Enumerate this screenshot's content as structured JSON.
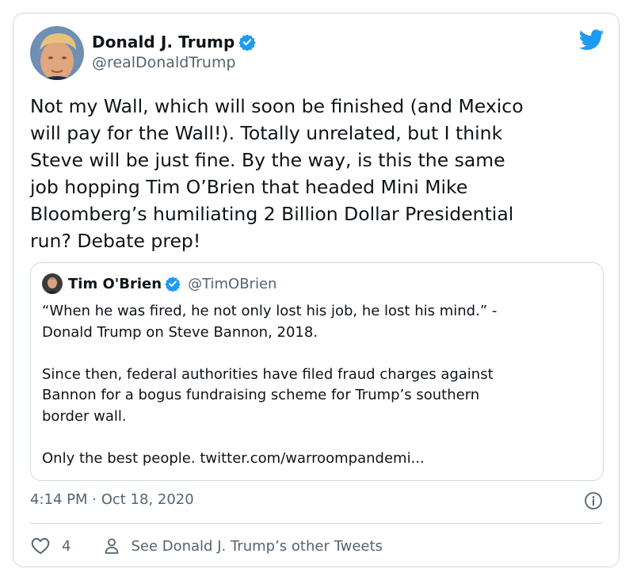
{
  "author": {
    "display_name": "Donald J. Trump",
    "handle": "@realDonaldTrump",
    "verified": true
  },
  "tweet": {
    "text": "Not my Wall, which will soon be finished (and Mexico\nwill pay for the Wall!). Totally unrelated, but I think\nSteve will be just fine. By the way, is this the same\njob hopping Tim O’Brien that headed Mini Mike\nBloomberg’s humiliating 2 Billion Dollar Presidential\nrun? Debate prep!",
    "timestamp": "4:14 PM · Oct 18, 2020"
  },
  "quoted_tweet": {
    "display_name": "Tim O'Brien",
    "handle": "@TimOBrien",
    "verified": true,
    "text": "“When he was fired, he not only lost his job, he lost his mind.” -\nDonald Trump on Steve Bannon, 2018.\n\nSince then, federal authorities have filed fraud charges against\nBannon for a bogus fundraising scheme for Trump’s southern\nborder wall.\n\nOnly the best people. twitter.com/warroompandemi..."
  },
  "actions": {
    "like_count": "4",
    "other_tweets_label": "See Donald J. Trump’s other Tweets"
  },
  "icons": {
    "brand": "twitter-bird-icon",
    "verified": "verified-badge-icon",
    "like": "heart-icon",
    "profile": "person-icon",
    "info": "info-icon"
  },
  "colors": {
    "brand_blue": "#1d9bf0",
    "text_primary": "#0f1419",
    "text_secondary": "#536471",
    "border": "#cfd9de"
  }
}
